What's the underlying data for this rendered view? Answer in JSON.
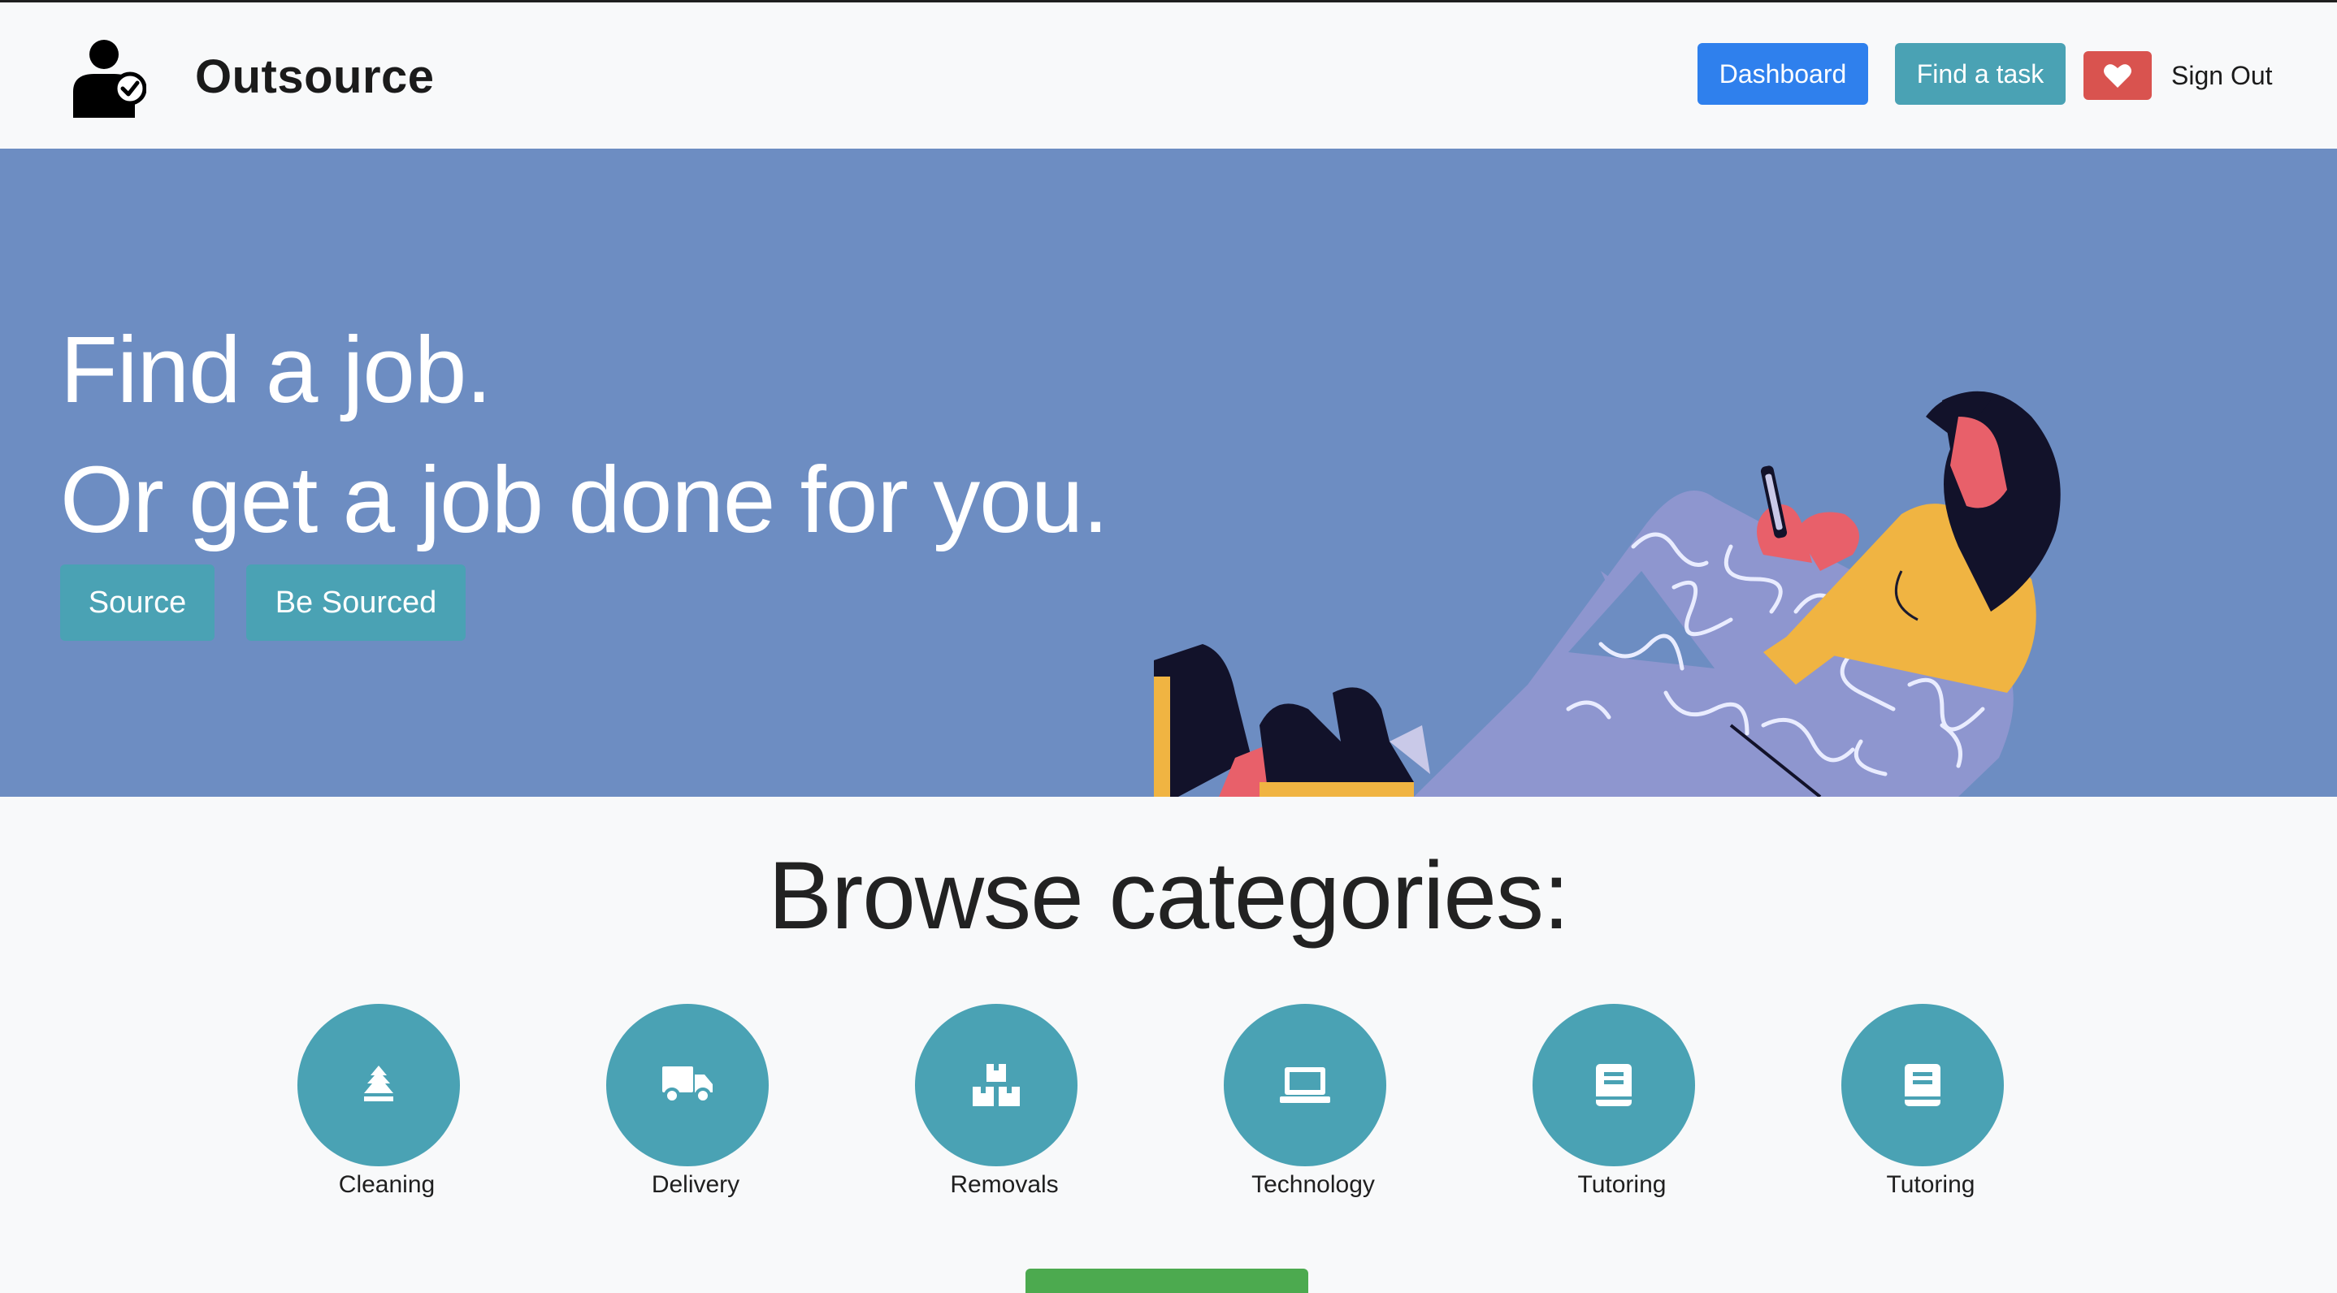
{
  "brand": {
    "name": "Outsource",
    "logo_icon": "person-check-icon"
  },
  "nav": {
    "dashboard_label": "Dashboard",
    "find_task_label": "Find a task",
    "favorites_icon": "heart-icon",
    "sign_out_label": "Sign Out"
  },
  "hero": {
    "line1": "Find a job.",
    "line2": "Or get a job done for you.",
    "buttons": {
      "source": "Source",
      "be_sourced": "Be Sourced"
    },
    "illustration": "woman-with-phone-illustration"
  },
  "categories": {
    "title": "Browse categories:",
    "items": [
      {
        "label": "Cleaning",
        "icon": "tree-icon"
      },
      {
        "label": "Delivery",
        "icon": "truck-icon"
      },
      {
        "label": "Removals",
        "icon": "boxes-icon"
      },
      {
        "label": "Technology",
        "icon": "laptop-icon"
      },
      {
        "label": "Tutoring",
        "icon": "book-icon"
      },
      {
        "label": "Tutoring",
        "icon": "book-icon"
      }
    ]
  },
  "colors": {
    "primary": "#2f80ed",
    "info": "#4aa2b4",
    "danger": "#d9534f",
    "hero_bg": "#6d8dc2",
    "success": "#4caa4f"
  }
}
